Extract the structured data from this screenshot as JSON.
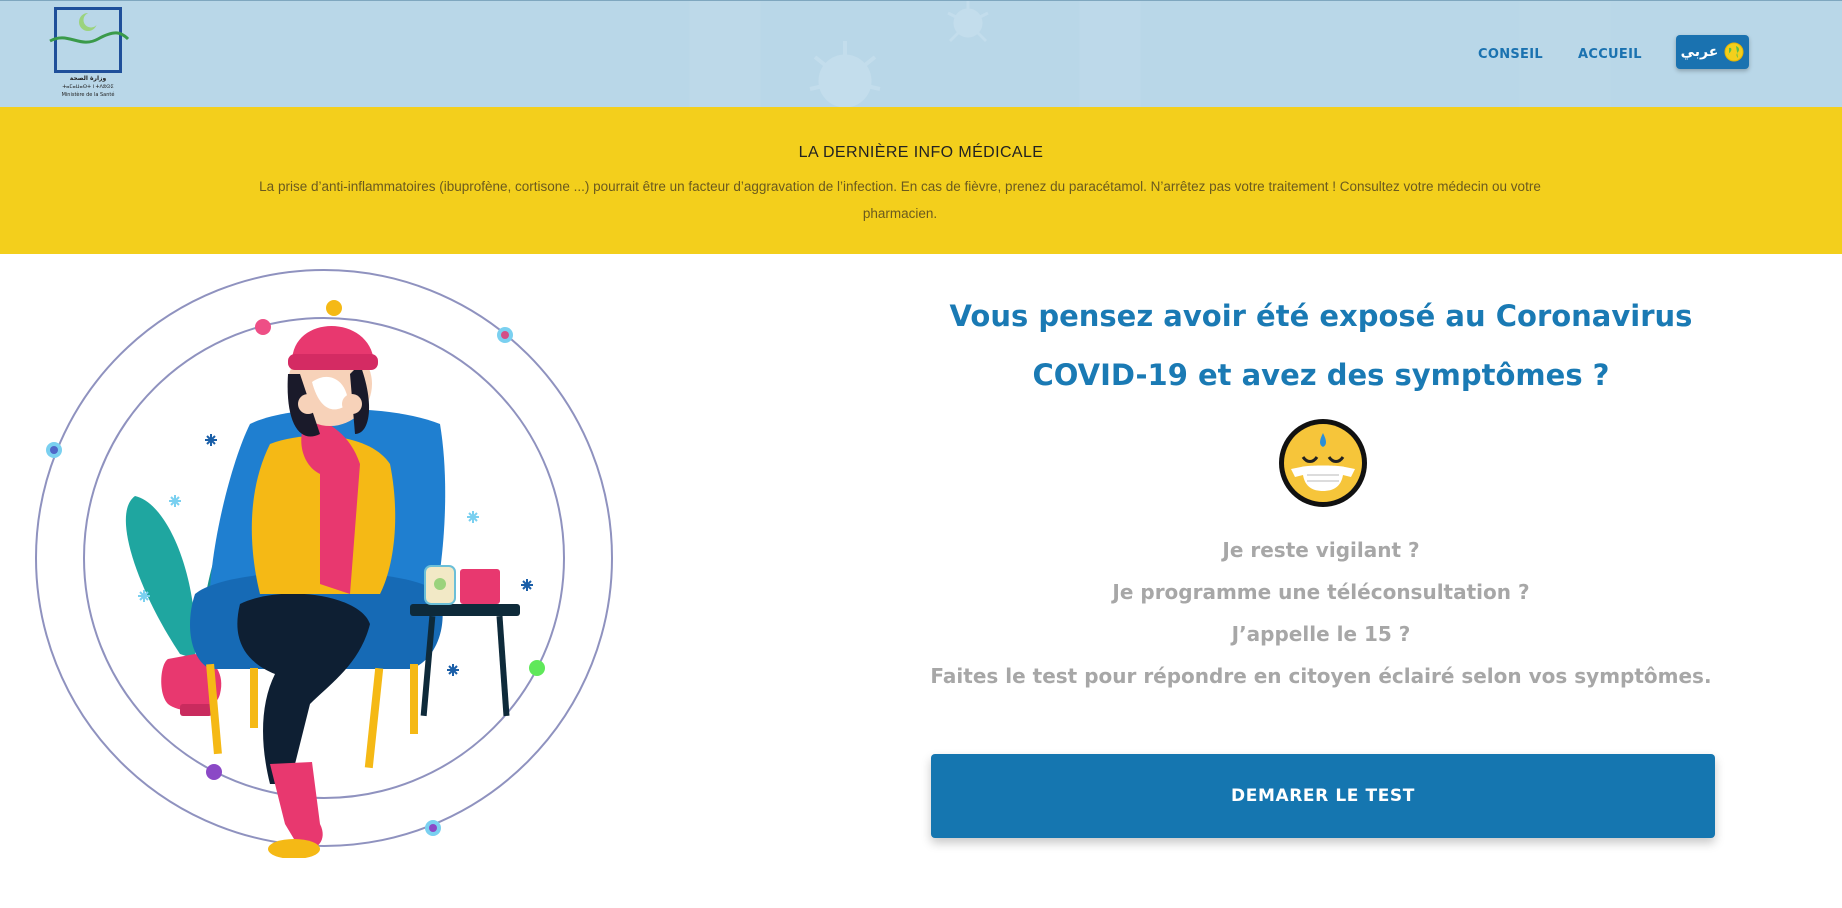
{
  "header": {
    "logo": {
      "line1": "وزارة الصحة",
      "line2": "ⵜⴰⵎⴰⵡⴰⵙⵜ ⵏ ⵜⴷⵓⵙⵉ",
      "line3": "Ministère de la Santé"
    },
    "nav": {
      "conseil": "CONSEIL",
      "accueil": "ACCUEIL"
    },
    "language_button": {
      "label": "عربي",
      "icon": "globe-icon"
    }
  },
  "banner": {
    "title": "LA DERNIÈRE INFO MÉDICALE",
    "text": "La prise d’anti-inflammatoires (ibuprofène, cortisone ...) pourrait être un facteur d’aggravation de l’infection. En cas de fièvre, prenez du paracétamol. N’arrêtez pas votre traitement ! Consultez votre médecin ou votre pharmacien."
  },
  "main": {
    "headline": "Vous pensez avoir été exposé au Coronavirus COVID-19 et avez des symptômes ?",
    "emoji": "masked-face-emoji",
    "questions": [
      "Je reste vigilant ?",
      "Je programme une téléconsultation ?",
      "J’appelle le 15 ?",
      "Faites le test pour répondre en citoyen éclairé selon vos symptômes."
    ],
    "start_button": "DEMARER LE TEST"
  },
  "colors": {
    "header_bg": "#b9d7e8",
    "banner_bg": "#f3cf1c",
    "accent_blue": "#1a7ab4",
    "button_blue": "#1576b0",
    "question_grey": "#a7a7a7"
  }
}
